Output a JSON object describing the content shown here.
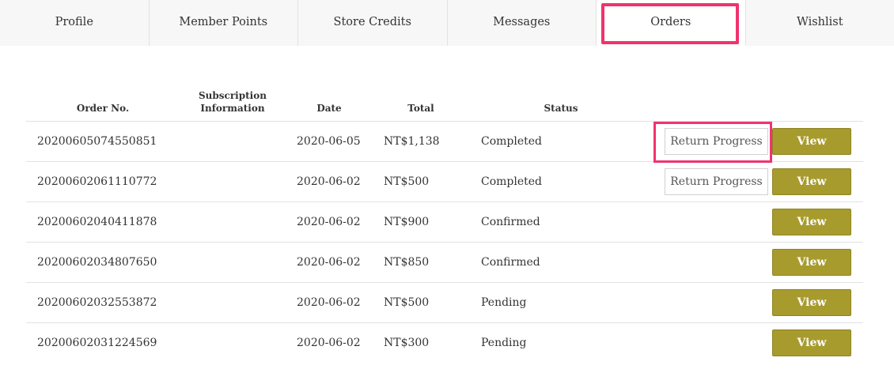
{
  "tabs": [
    {
      "label": "Profile"
    },
    {
      "label": "Member Points"
    },
    {
      "label": "Store Credits"
    },
    {
      "label": "Messages"
    },
    {
      "label": "Orders"
    },
    {
      "label": "Wishlist"
    }
  ],
  "active_tab": "Orders",
  "highlight_color": "#f0336e",
  "accent_color": "#a89b2d",
  "table": {
    "headers": {
      "order_no": "Order No.",
      "subscription": "Subscription Information",
      "date": "Date",
      "total": "Total",
      "status": "Status"
    },
    "rows": [
      {
        "order_no": "20200605074550851",
        "date": "2020-06-05",
        "total": "NT$1,138",
        "status": "Completed",
        "return_label": "Return Progress",
        "view_label": "View"
      },
      {
        "order_no": "20200602061110772",
        "date": "2020-06-02",
        "total": "NT$500",
        "status": "Completed",
        "return_label": "Return Progress",
        "view_label": "View"
      },
      {
        "order_no": "20200602040411878",
        "date": "2020-06-02",
        "total": "NT$900",
        "status": "Confirmed",
        "view_label": "View"
      },
      {
        "order_no": "20200602034807650",
        "date": "2020-06-02",
        "total": "NT$850",
        "status": "Confirmed",
        "view_label": "View"
      },
      {
        "order_no": "20200602032553872",
        "date": "2020-06-02",
        "total": "NT$500",
        "status": "Pending",
        "view_label": "View"
      },
      {
        "order_no": "20200602031224569",
        "date": "2020-06-02",
        "total": "NT$300",
        "status": "Pending",
        "view_label": "View"
      }
    ]
  }
}
